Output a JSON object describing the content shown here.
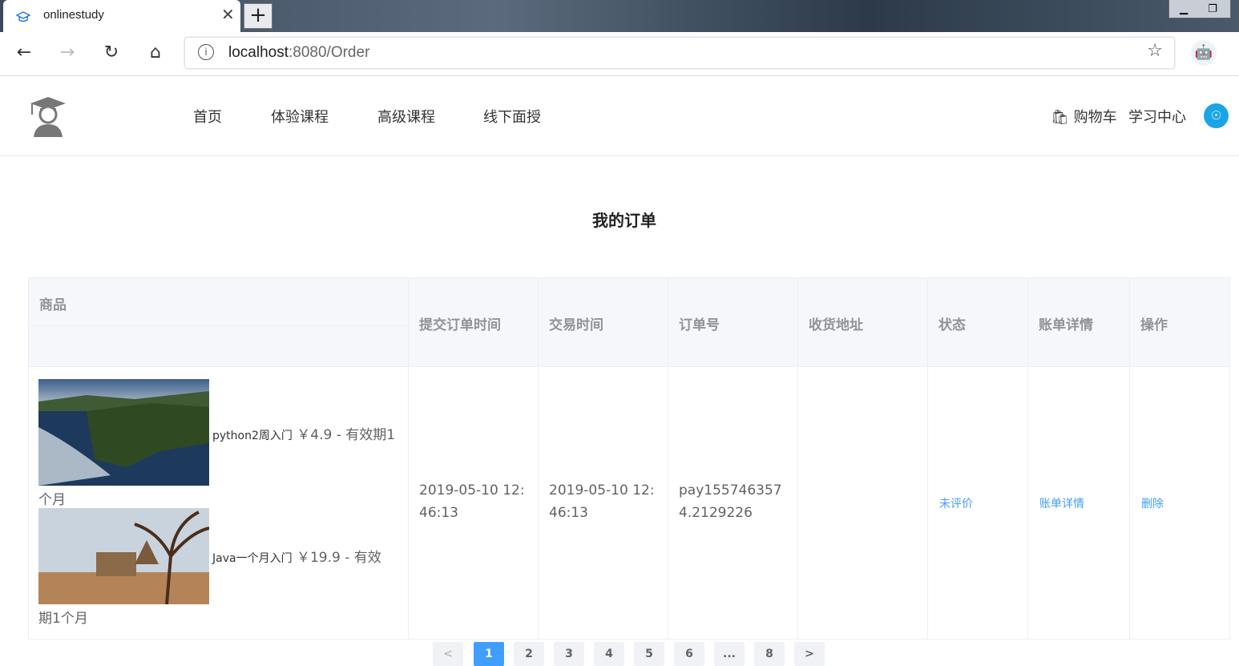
{
  "browser": {
    "tab_title": "onlinestudy",
    "new_tab": "+",
    "url_host": "localhost",
    "url_path": ":8080/Order"
  },
  "site": {
    "nav": [
      "首页",
      "体验课程",
      "高级课程",
      "线下面授"
    ],
    "cart": "购物车",
    "study_center": "学习中心"
  },
  "page": {
    "title": "我的订单"
  },
  "table": {
    "headers": {
      "product": "商品",
      "submit_time": "提交订单时间",
      "trade_time": "交易时间",
      "order_no": "订单号",
      "address": "收货地址",
      "status": "状态",
      "bill": "账单详情",
      "ops": "操作"
    },
    "row": {
      "items": [
        {
          "name": "python2周入门",
          "price_line": "￥4.9 - 有效期1",
          "tail": "个月"
        },
        {
          "name": "Java一个月入门",
          "price_line": "￥19.9 - 有效",
          "tail": "期1个月"
        }
      ],
      "submit_time": "2019-05-10 12:46:13",
      "trade_time": "2019-05-10 12:46:13",
      "order_no": "pay1557463574.2129226",
      "address": "",
      "status_link": "未评价",
      "bill_link": "账单详情",
      "delete_link": "删除"
    }
  },
  "pagination": {
    "prev": "<",
    "pages": [
      "1",
      "2",
      "3",
      "4",
      "5",
      "6",
      "...",
      "8"
    ],
    "next": ">",
    "active": "1"
  },
  "colors": {
    "link": "#409eff",
    "avatar": "#1aa5e6"
  }
}
